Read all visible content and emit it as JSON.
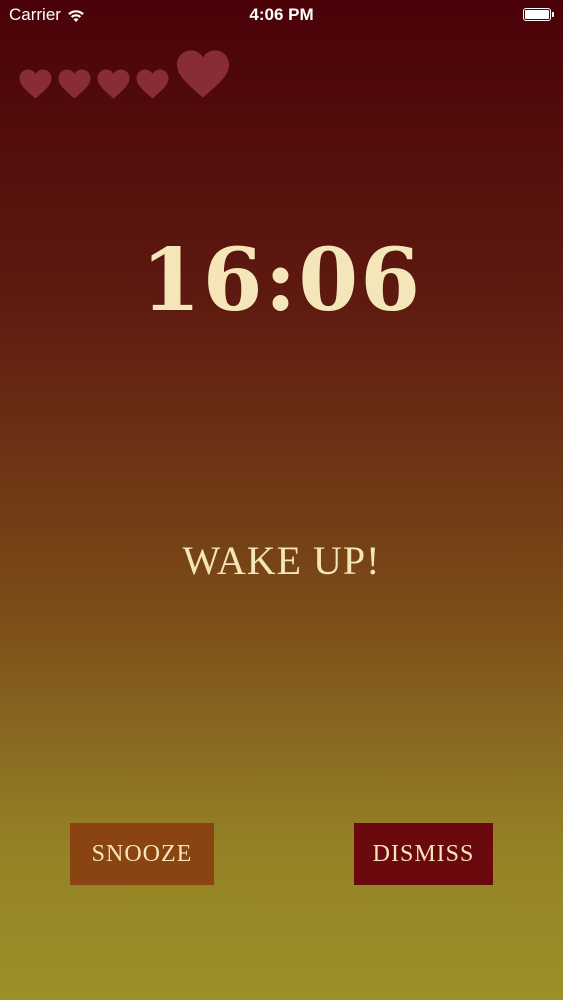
{
  "status_bar": {
    "carrier": "Carrier",
    "time": "4:06 PM",
    "wifi_icon": "wifi-icon",
    "battery_icon": "battery-icon"
  },
  "hearts": {
    "icon": "heart-icon",
    "count": 5,
    "color": "#9b3a46"
  },
  "clock": {
    "time": "16:06"
  },
  "alarm": {
    "message": "WAKE UP!"
  },
  "actions": {
    "snooze_label": "SNOOZE",
    "dismiss_label": "DISMISS",
    "snooze_color": "#8a4412",
    "dismiss_color": "#6a0a0e"
  }
}
